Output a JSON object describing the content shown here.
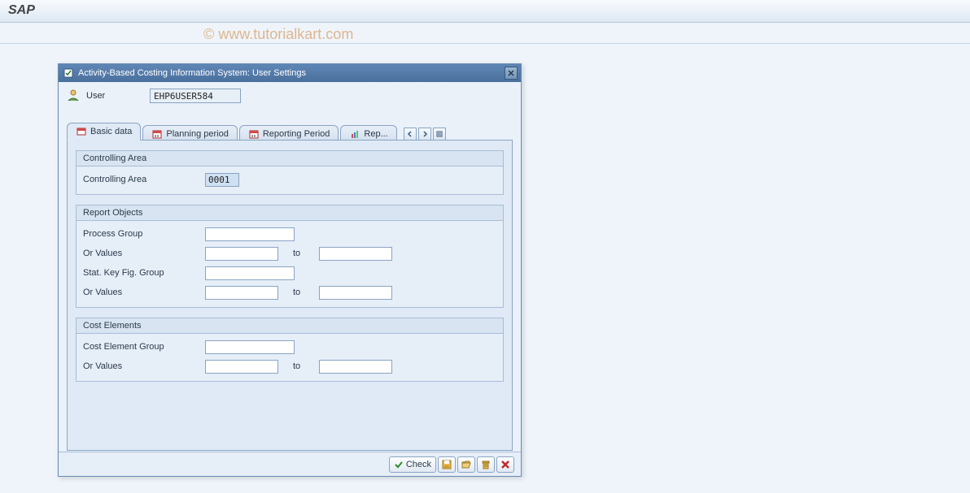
{
  "app": {
    "title": "SAP"
  },
  "watermark": "© www.tutorialkart.com",
  "dialog": {
    "title": "Activity-Based Costing Information System: User Settings",
    "user": {
      "label": "User",
      "value": "EHP6USER584"
    },
    "tabs": {
      "basic_data": "Basic data",
      "planning_period": "Planning period",
      "reporting_period": "Reporting Period",
      "rep": "Rep..."
    },
    "groups": {
      "controlling_area": {
        "title": "Controlling Area",
        "field_label": "Controlling Area",
        "value": "0001"
      },
      "report_objects": {
        "title": "Report Objects",
        "process_group_label": "Process Group",
        "process_group_value": "",
        "or_values1_label": "Or Values",
        "or_values1_from": "",
        "or_values1_to_label": "to",
        "or_values1_to": "",
        "skf_group_label": "Stat. Key Fig. Group",
        "skf_group_value": "",
        "or_values2_label": "Or Values",
        "or_values2_from": "",
        "or_values2_to_label": "to",
        "or_values2_to": ""
      },
      "cost_elements": {
        "title": "Cost Elements",
        "ceg_label": "Cost Element Group",
        "ceg_value": "",
        "or_values_label": "Or Values",
        "or_values_from": "",
        "or_values_to_label": "to",
        "or_values_to": ""
      }
    },
    "footer": {
      "check_label": "Check"
    }
  }
}
